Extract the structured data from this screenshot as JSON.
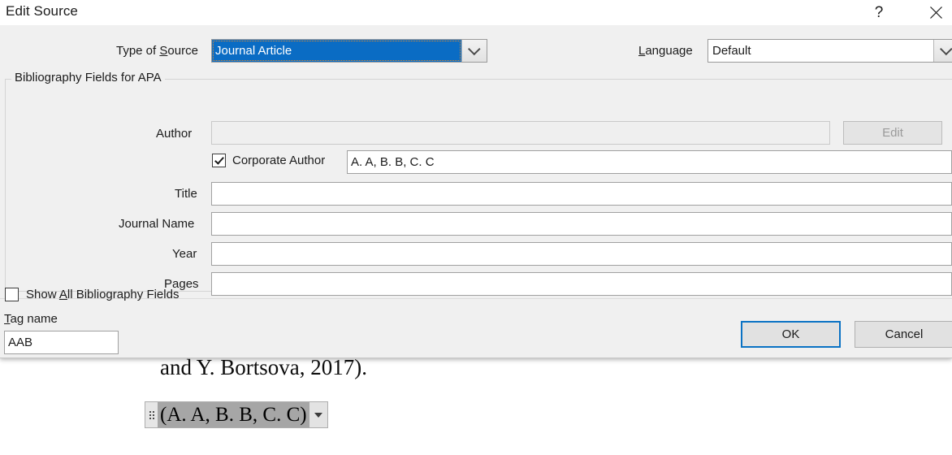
{
  "document": {
    "text_line": "and Y. Bortsova, 2017).",
    "citation_field": {
      "text": "(A. A, B. B, C. C)",
      "handle_icon": "drag-handle-icon",
      "dropdown_icon": "caret-down-icon"
    }
  },
  "dialog": {
    "title": "Edit Source",
    "help_icon": "question-mark-icon",
    "close_icon": "close-x-icon",
    "type_of_source": {
      "label_before": "Type of ",
      "label_accel": "S",
      "label_after": "ource",
      "value": "Journal Article",
      "dropdown_icon": "chevron-down-icon",
      "selected": true,
      "highlight_color": "#0a6cc4"
    },
    "language": {
      "label_accel": "L",
      "label_after": "anguage",
      "value": "Default",
      "dropdown_icon": "chevron-down-icon"
    },
    "groupbox": {
      "label": "Bibliography Fields for APA"
    },
    "fields": {
      "author": {
        "label": "Author",
        "value": "",
        "disabled": true
      },
      "edit_button": {
        "label": "Edit",
        "disabled": true
      },
      "corporate_author": {
        "label": "Corporate Author",
        "checked": true,
        "value": "A. A, B. B, C. C"
      },
      "title": {
        "label": "Title",
        "value": ""
      },
      "journal_name": {
        "label": "Journal Name",
        "value": ""
      },
      "year": {
        "label": "Year",
        "value": ""
      },
      "pages": {
        "label": "Pages",
        "value": ""
      }
    },
    "show_all_bibliography_fields": {
      "label_before": "Show ",
      "label_accel": "A",
      "label_after": "ll Bibliography Fields",
      "checked": false
    },
    "tag_name": {
      "label_accel": "T",
      "label_after": "ag name",
      "value": "AAB"
    },
    "buttons": {
      "ok": "OK",
      "cancel": "Cancel"
    },
    "accent_color": "#0a72c4"
  }
}
